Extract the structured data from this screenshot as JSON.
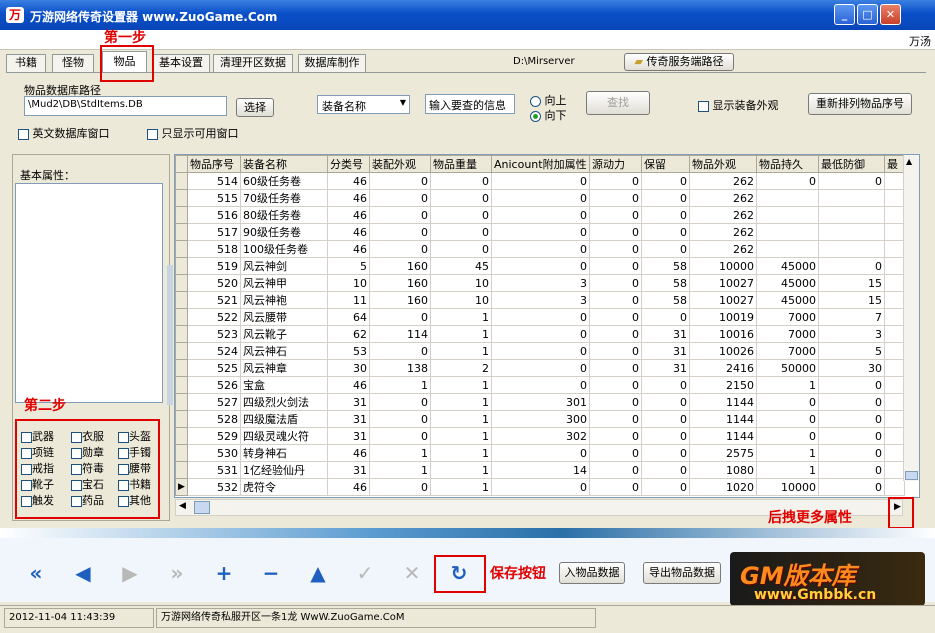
{
  "window": {
    "title": "万游网络传奇设置器 www.ZuoGame.Com",
    "logo_text": "万"
  },
  "menubar": {
    "right_text": "万汤"
  },
  "tabs": [
    "书籍",
    "怪物",
    "物品",
    "基本设置",
    "清理开区数据",
    "数据库制作"
  ],
  "active_tab": "物品",
  "server": {
    "path": "D:\\Mirserver",
    "button": "传奇服务端路径"
  },
  "db_path": {
    "label": "物品数据库路径",
    "value": "\\Mud2\\DB\\StdItems.DB",
    "select_button": "选择"
  },
  "search": {
    "field_select": "装备名称",
    "input_placeholder": "输入要查的信息",
    "radio_up": "向上",
    "radio_down": "向下",
    "radio_selected": "向下",
    "find_button": "查找"
  },
  "options": {
    "show_appearance": "显示装备外观",
    "reorder_button": "重新排列物品序号",
    "english_db_window": "英文数据库窗口",
    "only_available_window": "只显示可用窗口"
  },
  "left_panel": {
    "basic_attr_label": "基本属性："
  },
  "categories": [
    "武器",
    "衣服",
    "头盔",
    "项链",
    "勋章",
    "手镯",
    "戒指",
    "符毒",
    "腰带",
    "靴子",
    "宝石",
    "书籍",
    "触发",
    "药品",
    "其他"
  ],
  "annotations": {
    "step1": "第一步",
    "step2": "第二步",
    "save": "保存按钮",
    "more_attrs": "后拽更多属性"
  },
  "table": {
    "columns": [
      "物品序号",
      "装备名称",
      "分类号",
      "装配外观",
      "物品重量",
      "Anicount附加属性",
      "源动力",
      "保留",
      "物品外观",
      "物品持久",
      "最低防御",
      "最"
    ],
    "rows": [
      [
        "514",
        "60级任务卷",
        "46",
        "0",
        "0",
        "0",
        "0",
        "0",
        "262",
        "0",
        "0"
      ],
      [
        "515",
        "70级任务卷",
        "46",
        "0",
        "0",
        "0",
        "0",
        "0",
        "262",
        "",
        ""
      ],
      [
        "516",
        "80级任务卷",
        "46",
        "0",
        "0",
        "0",
        "0",
        "0",
        "262",
        "",
        ""
      ],
      [
        "517",
        "90级任务卷",
        "46",
        "0",
        "0",
        "0",
        "0",
        "0",
        "262",
        "",
        ""
      ],
      [
        "518",
        "100级任务卷",
        "46",
        "0",
        "0",
        "0",
        "0",
        "0",
        "262",
        "",
        ""
      ],
      [
        "519",
        "风云神剑",
        "5",
        "160",
        "45",
        "0",
        "0",
        "58",
        "10000",
        "45000",
        "0"
      ],
      [
        "520",
        "风云神甲",
        "10",
        "160",
        "10",
        "3",
        "0",
        "58",
        "10027",
        "45000",
        "15"
      ],
      [
        "521",
        "风云神袍",
        "11",
        "160",
        "10",
        "3",
        "0",
        "58",
        "10027",
        "45000",
        "15"
      ],
      [
        "522",
        "风云腰带",
        "64",
        "0",
        "1",
        "0",
        "0",
        "0",
        "10019",
        "7000",
        "7"
      ],
      [
        "523",
        "风云靴子",
        "62",
        "114",
        "1",
        "0",
        "0",
        "31",
        "10016",
        "7000",
        "3"
      ],
      [
        "524",
        "风云神石",
        "53",
        "0",
        "1",
        "0",
        "0",
        "31",
        "10026",
        "7000",
        "5"
      ],
      [
        "525",
        "风云神章",
        "30",
        "138",
        "2",
        "0",
        "0",
        "31",
        "2416",
        "50000",
        "30"
      ],
      [
        "526",
        "宝盒",
        "46",
        "1",
        "1",
        "0",
        "0",
        "0",
        "2150",
        "1",
        "0"
      ],
      [
        "527",
        "四级烈火剑法",
        "31",
        "0",
        "1",
        "301",
        "0",
        "0",
        "1144",
        "0",
        "0"
      ],
      [
        "528",
        "四级魔法盾",
        "31",
        "0",
        "1",
        "300",
        "0",
        "0",
        "1144",
        "0",
        "0"
      ],
      [
        "529",
        "四级灵魂火符",
        "31",
        "0",
        "1",
        "302",
        "0",
        "0",
        "1144",
        "0",
        "0"
      ],
      [
        "530",
        "转身神石",
        "46",
        "1",
        "1",
        "0",
        "0",
        "0",
        "2575",
        "1",
        "0"
      ],
      [
        "531",
        "1亿经验仙丹",
        "31",
        "1",
        "1",
        "14",
        "0",
        "0",
        "1080",
        "1",
        "0"
      ],
      [
        "532",
        "虎符令",
        "46",
        "0",
        "1",
        "0",
        "0",
        "0",
        "1020",
        "10000",
        "0"
      ]
    ],
    "current_row": 18
  },
  "buttons": {
    "import": "入物品数据",
    "export": "导出物品数据"
  },
  "watermark": {
    "brand": "GM版本库",
    "url": "www.Gmbbk.cn"
  },
  "status": {
    "datetime": "2012-11-04 11:43:39",
    "message": "万游网络传奇私服开区一条1龙 WwW.ZuoGame.CoM"
  }
}
